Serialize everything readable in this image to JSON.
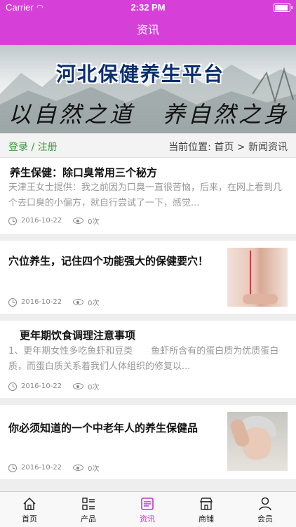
{
  "status": {
    "carrier": "Carrier",
    "time": "2:32 PM"
  },
  "nav": {
    "title": "资讯"
  },
  "banner": {
    "title": "河北保健养生平台",
    "callig_left": "以自然之道",
    "callig_right": "养自然之身"
  },
  "breadcrumb": {
    "login": "登录 / 注册",
    "location": "当前位置:   首页 > 新闻资讯"
  },
  "articles": [
    {
      "title": "养生保健：除口臭常用三个秘方",
      "excerpt": "天津王女士提供：我之前因为口臭一直很苦恼，后来，在网上看到几个去口臭的小偏方，就自行尝试了一下，感觉...",
      "date": "2016-10-22",
      "views": "0次"
    },
    {
      "title": "穴位养生，记住四个功能强大的保健要穴！",
      "date": "2016-10-22",
      "views": "0次"
    },
    {
      "title": "更年期饮食调理注意事项",
      "excerpt": "1、更年期女性多吃鱼虾和豆类　　鱼虾所含有的蛋白质为优质蛋白质，而蛋白质关系着我们人体组织的修复以...",
      "date": "2016-10-22",
      "views": "0次"
    },
    {
      "title": "你必须知道的一个中老年人的养生保健品",
      "date": "2016-10-22",
      "views": "0次"
    }
  ],
  "tabs": [
    {
      "label": "首页"
    },
    {
      "label": "产品"
    },
    {
      "label": "资讯",
      "active": true
    },
    {
      "label": "商铺"
    },
    {
      "label": "会员"
    }
  ],
  "colors": {
    "accent": "#d63fd8",
    "active_tab": "#c436c6",
    "login_green": "#3a9b3a"
  }
}
